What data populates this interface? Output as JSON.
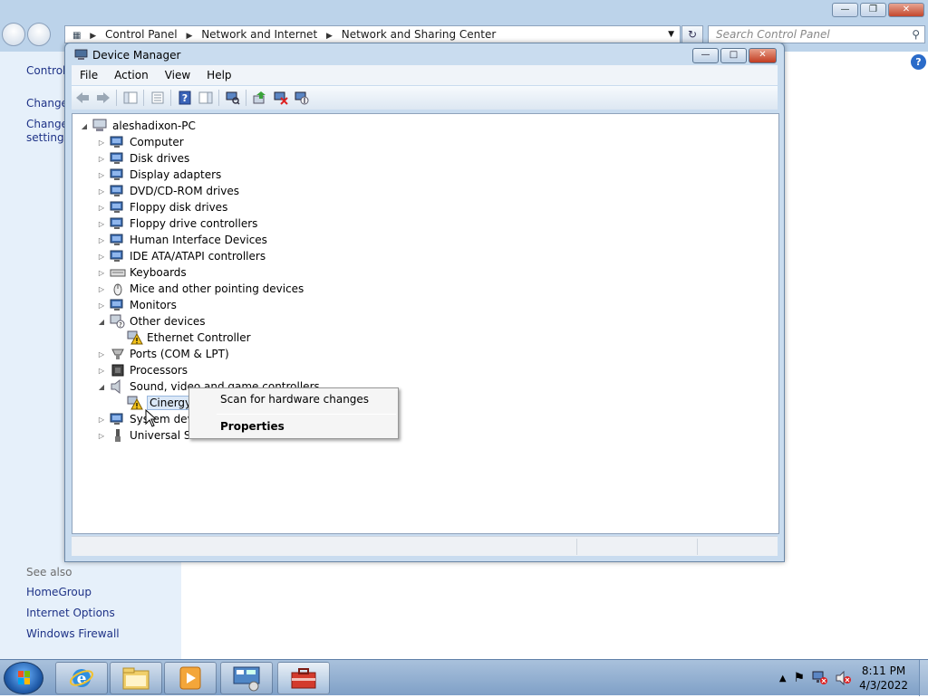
{
  "control_panel": {
    "breadcrumb": [
      "Control Panel",
      "Network and Internet",
      "Network and Sharing Center"
    ],
    "search_placeholder": "Search Control Panel",
    "left_links": [
      "Control",
      "Change",
      "Change",
      "settings"
    ],
    "see_also_label": "See also",
    "see_also": [
      "HomeGroup",
      "Internet Options",
      "Windows Firewall"
    ]
  },
  "device_manager": {
    "title": "Device Manager",
    "menu": [
      "File",
      "Action",
      "View",
      "Help"
    ],
    "root": "aleshadixon-PC",
    "tree": [
      {
        "label": "Computer",
        "icon": "computer-icon",
        "expanded": false
      },
      {
        "label": "Disk drives",
        "icon": "disk-drive-icon",
        "expanded": false
      },
      {
        "label": "Display adapters",
        "icon": "display-adapter-icon",
        "expanded": false
      },
      {
        "label": "DVD/CD-ROM drives",
        "icon": "dvd-drive-icon",
        "expanded": false
      },
      {
        "label": "Floppy disk drives",
        "icon": "floppy-disk-icon",
        "expanded": false
      },
      {
        "label": "Floppy drive controllers",
        "icon": "floppy-controller-icon",
        "expanded": false
      },
      {
        "label": "Human Interface Devices",
        "icon": "hid-icon",
        "expanded": false
      },
      {
        "label": "IDE ATA/ATAPI controllers",
        "icon": "ide-controller-icon",
        "expanded": false
      },
      {
        "label": "Keyboards",
        "icon": "keyboard-icon",
        "expanded": false
      },
      {
        "label": "Mice and other pointing devices",
        "icon": "mouse-icon",
        "expanded": false
      },
      {
        "label": "Monitors",
        "icon": "monitor-icon",
        "expanded": false
      },
      {
        "label": "Other devices",
        "icon": "unknown-device-icon",
        "expanded": true,
        "children": [
          {
            "label": "Ethernet Controller",
            "icon": "warning-device-icon"
          }
        ]
      },
      {
        "label": "Ports (COM & LPT)",
        "icon": "port-icon",
        "expanded": false
      },
      {
        "label": "Processors",
        "icon": "processor-icon",
        "expanded": false
      },
      {
        "label": "Sound, video and game controllers",
        "icon": "speaker-icon",
        "expanded": true,
        "children": [
          {
            "label": "Cinergy (",
            "icon": "warning-device-icon",
            "selected": true
          }
        ]
      },
      {
        "label": "System devic",
        "icon": "system-device-icon",
        "expanded": false
      },
      {
        "label": "Universal Ser",
        "icon": "usb-icon",
        "expanded": false
      }
    ]
  },
  "context_menu": {
    "items": [
      "Scan for hardware changes",
      "Properties"
    ]
  },
  "taskbar": {
    "time": "8:11 PM",
    "date": "4/3/2022",
    "apps": [
      "internet-explorer-icon",
      "windows-explorer-icon",
      "media-player-icon",
      "control-panel-icon",
      "device-manager-icon"
    ]
  }
}
